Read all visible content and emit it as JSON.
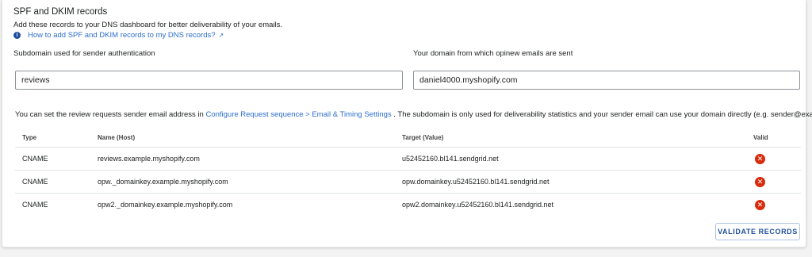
{
  "section": {
    "title": "SPF and DKIM records",
    "description": "Add these records to your DNS dashboard for better deliverability of your emails.",
    "help_link": "How to add SPF and DKIM records to my DNS records?"
  },
  "fields": {
    "subdomain_label": "Subdomain used for sender authentication",
    "subdomain_value": "reviews",
    "domain_label": "Your domain from which opinew emails are sent",
    "domain_value": "daniel4000.myshopify.com"
  },
  "note": {
    "prefix": "You can set the review requests sender email address in",
    "link": "Configure Request sequence > Email & Timing Settings",
    "suffix": ". The subdomain is only used for deliverability statistics and your sender email can use your domain directly (e.g. sender@example.com)."
  },
  "table": {
    "headers": {
      "type": "Type",
      "name": "Name (Host)",
      "target": "Target (Value)",
      "valid": "Valid"
    },
    "rows": [
      {
        "type": "CNAME",
        "name": "reviews.example.myshopify.com",
        "target": "u52452160.bl141.sendgrid.net",
        "valid": false
      },
      {
        "type": "CNAME",
        "name": "opw._domainkey.example.myshopify.com",
        "target": "opw.domainkey.u52452160.bl141.sendgrid.net",
        "valid": false
      },
      {
        "type": "CNAME",
        "name": "opw2._domainkey.example.myshopify.com",
        "target": "opw2.domainkey.u52452160.bl141.sendgrid.net",
        "valid": false
      }
    ]
  },
  "actions": {
    "validate_label": "VALIDATE RECORDS"
  },
  "icons": {
    "info": "info-icon",
    "external_link": "external-link-icon",
    "invalid": "error-circle-icon"
  },
  "colors": {
    "link": "#2c6ecb",
    "error": "#d72c0d",
    "primary": "#1f4e9c"
  }
}
